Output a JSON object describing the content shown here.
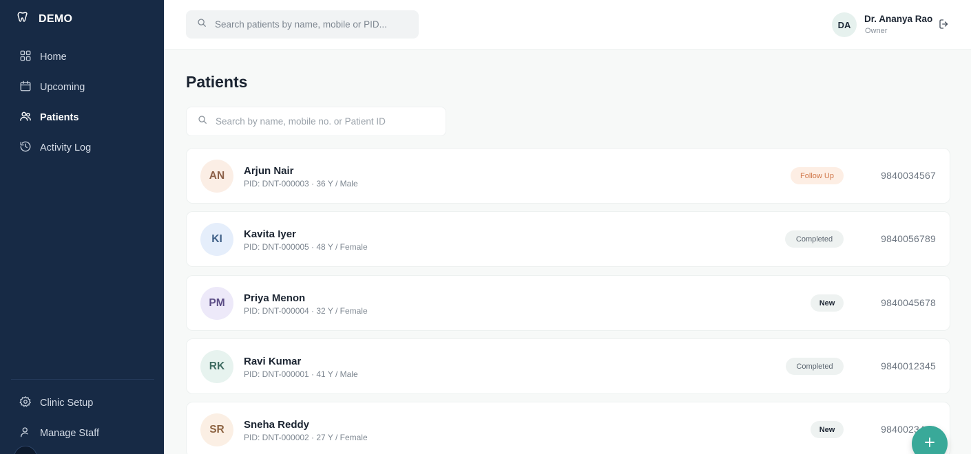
{
  "brand": {
    "label": "DEMO",
    "icon": "tooth-icon"
  },
  "nav": {
    "items": [
      {
        "label": "Home",
        "icon": "grid-icon"
      },
      {
        "label": "Upcoming",
        "icon": "calendar-icon"
      },
      {
        "label": "Patients",
        "icon": "users-icon"
      },
      {
        "label": "Activity Log",
        "icon": "history-icon"
      }
    ],
    "active": "Patients",
    "bottom_items": [
      {
        "label": "Clinic Setup",
        "icon": "gear-icon"
      },
      {
        "label": "Manage Staff",
        "icon": "user-icon"
      }
    ]
  },
  "topbar": {
    "search_placeholder": "Search patients by name, mobile or PID...",
    "user": {
      "initials": "DA",
      "name": "Dr. Ananya Rao",
      "role": "Owner"
    }
  },
  "page": {
    "title": "Patients",
    "search_placeholder": "Search by name, mobile no. or Patient ID"
  },
  "patients": [
    {
      "initials": "AN",
      "name": "Arjun Nair",
      "meta": "PID: DNT-000003 · 36 Y / Male",
      "status": "Follow Up",
      "phone": "9840034567"
    },
    {
      "initials": "KI",
      "name": "Kavita Iyer",
      "meta": "PID: DNT-000005 · 48 Y / Female",
      "status": "Completed",
      "phone": "9840056789"
    },
    {
      "initials": "PM",
      "name": "Priya Menon",
      "meta": "PID: DNT-000004 · 32 Y / Female",
      "status": "New",
      "phone": "9840045678"
    },
    {
      "initials": "RK",
      "name": "Ravi Kumar",
      "meta": "PID: DNT-000001 · 41 Y / Male",
      "status": "Completed",
      "phone": "9840012345"
    },
    {
      "initials": "SR",
      "name": "Sneha Reddy",
      "meta": "PID: DNT-000002 · 27 Y / Female",
      "status": "New",
      "phone": "9840023456"
    }
  ],
  "colors": {
    "sidebar_bg": "#172a45",
    "accent": "#39a999",
    "follow_up_bg": "#fdeee4",
    "follow_up_fg": "#d0774a",
    "completed_bg": "#eef2f1",
    "completed_fg": "#5b6570",
    "new_bg": "#eef2f1",
    "new_fg": "#1b2431"
  }
}
